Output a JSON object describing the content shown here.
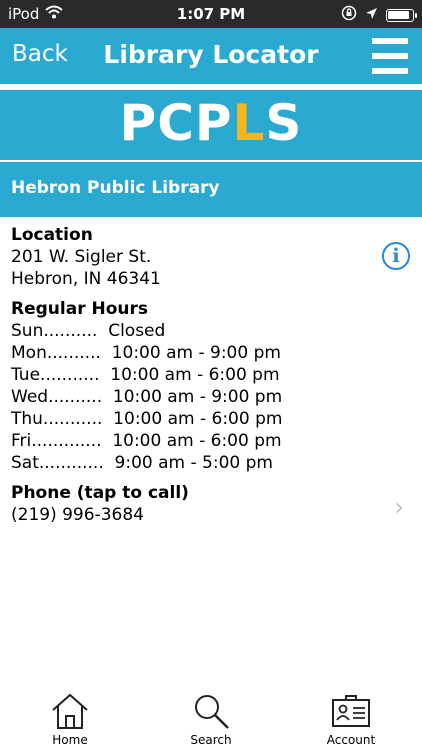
{
  "status_bar": {
    "carrier": "iPod",
    "time": "1:07 PM"
  },
  "nav": {
    "back_label": "Back",
    "title": "Library Locator"
  },
  "logo": {
    "part1": "PCP",
    "accent_letter": "L",
    "part2": "S",
    "accent_color": "#f7b51e"
  },
  "library": {
    "name": "Hebron Public Library"
  },
  "location": {
    "title": "Location",
    "street": "201 W. Sigler St.",
    "city": "Hebron, IN 46341"
  },
  "hours": {
    "title": "Regular Hours",
    "rows": [
      {
        "day": "Sun..........",
        "time": "  Closed"
      },
      {
        "day": "Mon..........",
        "time": "  10:00 am - 9:00 pm"
      },
      {
        "day": "Tue...........",
        "time": "  10:00 am - 6:00 pm"
      },
      {
        "day": "Wed..........",
        "time": "  10:00 am - 9:00 pm"
      },
      {
        "day": "Thu...........",
        "time": "  10:00 am - 6:00 pm"
      },
      {
        "day": "Fri.............",
        "time": "  10:00 am - 6:00 pm"
      },
      {
        "day": "Sat............",
        "time": "  9:00 am - 5:00 pm"
      }
    ]
  },
  "phone": {
    "title": "Phone (tap to call)",
    "number": "(219) 996-3684"
  },
  "tabs": [
    {
      "label": "Home",
      "icon": "home-icon"
    },
    {
      "label": "Search",
      "icon": "search-icon"
    },
    {
      "label": "Account",
      "icon": "account-card-icon"
    }
  ],
  "colors": {
    "brand": "#2aaad0",
    "info": "#2a86d8"
  }
}
